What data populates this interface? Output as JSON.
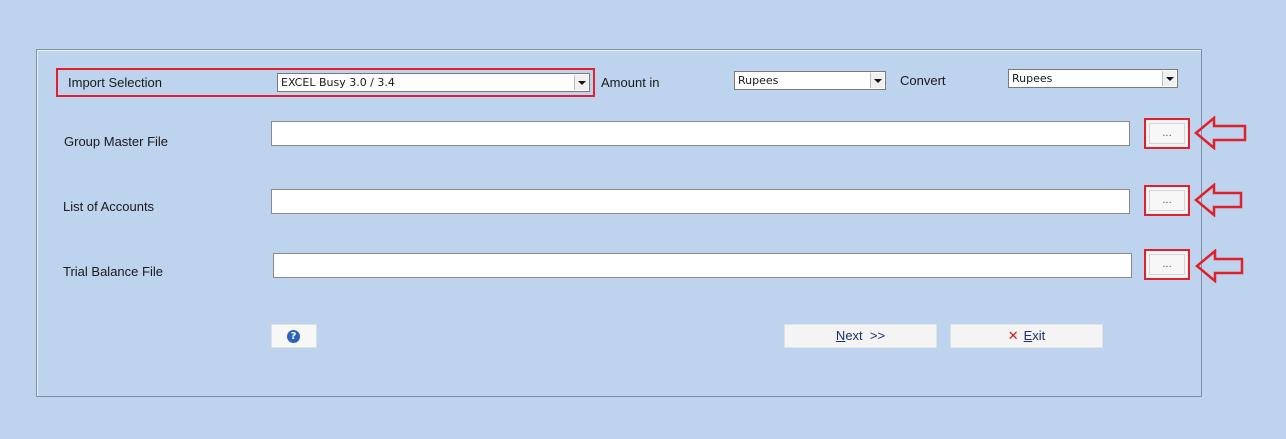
{
  "form": {
    "import_selection": {
      "label": "Import Selection",
      "value": "EXCEL Busy 3.0 / 3.4"
    },
    "amount_in": {
      "label": "Amount in",
      "value": "Rupees"
    },
    "convert": {
      "label": "Convert",
      "value": "Rupees"
    },
    "files": [
      {
        "label": "Group Master File",
        "value": "",
        "browse_label": "..."
      },
      {
        "label": "List of Accounts",
        "value": "",
        "browse_label": "..."
      },
      {
        "label": "Trial Balance File",
        "value": "",
        "browse_label": "..."
      }
    ]
  },
  "buttons": {
    "help_label": "?",
    "next": {
      "first": "N",
      "rest": "ext  >>"
    },
    "exit": {
      "icon": "✕",
      "first": "E",
      "rest": "xit"
    }
  },
  "colors": {
    "background": "#bdd3ee",
    "highlight": "#e0202a"
  },
  "icons": {
    "annotation": "left-arrow-icon",
    "help": "help-icon",
    "exit": "close-icon"
  }
}
